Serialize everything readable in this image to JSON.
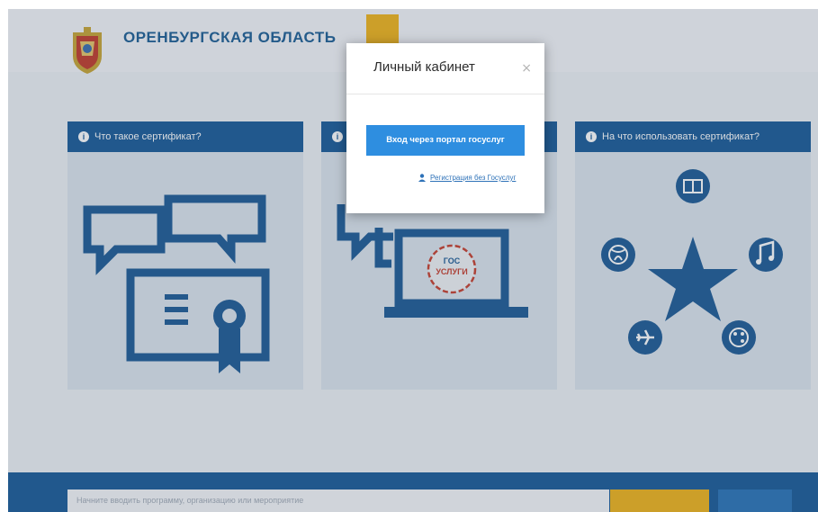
{
  "header": {
    "org_title": "ОРЕНБУРГСКАЯ ОБЛАСТЬ",
    "org_subtitle": "",
    "nav": [
      "",
      "",
      "",
      "",
      "",
      ""
    ],
    "lang": ""
  },
  "cards": [
    {
      "title": "Что такое сертификат?",
      "icon": "certificate-icon"
    },
    {
      "title": "",
      "icon": "laptop-gosuslugi-icon"
    },
    {
      "title": "На что использовать сертификат?",
      "icon": "star-hobbies-icon"
    }
  ],
  "modal": {
    "title": "Личный кабинет",
    "close": "×",
    "login_button": "Вход через портал госуслуг",
    "register_link": "Регистрация без Госуслуг",
    "laptop_badge": "ГОС УСЛУГИ"
  },
  "footer": {
    "search_placeholder": "Начните вводить программу, организацию или мероприятие",
    "yellow_button": "",
    "blue_button": ""
  },
  "colors": {
    "primary": "#1b5c99",
    "accent": "#f0b41c",
    "modal_button": "#2e8ee0",
    "card_bg": "#dde5ee"
  }
}
